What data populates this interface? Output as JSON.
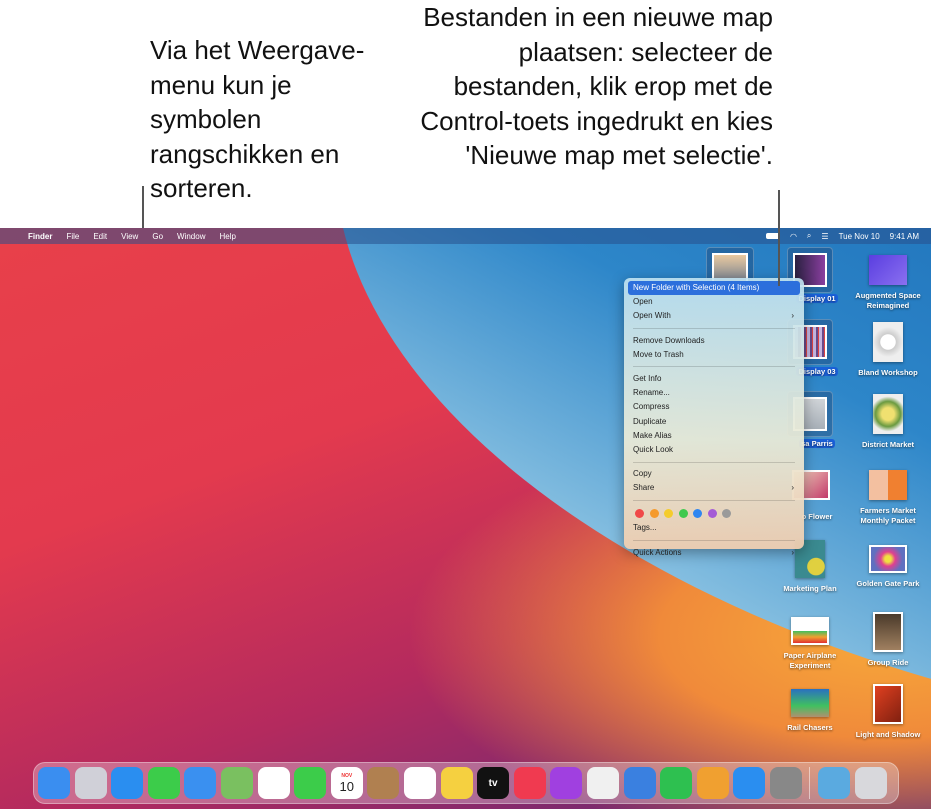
{
  "callouts": {
    "left": "Via het Weergave-menu kun je symbolen rangschikken en sorteren.",
    "right": "Bestanden in een nieuwe map plaatsen: selecteer de bestanden, klik erop met de Control-toets ingedrukt en kies 'Nieuwe map met selectie'."
  },
  "menubar": {
    "apple": "",
    "items": [
      "Finder",
      "File",
      "Edit",
      "View",
      "Go",
      "Window",
      "Help"
    ],
    "date": "Tue Nov 10",
    "time": "9:41 AM"
  },
  "context_menu": {
    "items": [
      "New Folder with Selection (4 Items)",
      "Open",
      "Open With",
      "Remove Downloads",
      "Move to Trash",
      "Get Info",
      "Rename...",
      "Compress",
      "Duplicate",
      "Make Alias",
      "Quick Look",
      "Copy",
      "Share",
      "Tags...",
      "Quick Actions"
    ],
    "tag_colors": [
      "#f04848",
      "#f59a2c",
      "#f5cc2c",
      "#3fc94e",
      "#2f86f0",
      "#a45bd6",
      "#9a9a9a"
    ]
  },
  "desktop": {
    "selected": [
      "Display 01",
      "Display 03",
      "sa Parris"
    ],
    "other_partial": [
      "o Flower"
    ],
    "icons": [
      "Augmented Space Reimagined",
      "Bland Workshop",
      "District Market",
      "Farmers Market Monthly Packet",
      "Golden Gate Park",
      "Group Ride",
      "Light and Shadow",
      "Marketing Plan",
      "Paper Airplane Experiment",
      "Rail Chasers"
    ]
  },
  "dock": {
    "apps": [
      "Finder",
      "Launchpad",
      "Safari",
      "Messages",
      "Mail",
      "Maps",
      "Photos",
      "FaceTime",
      "Calendar",
      "Contacts",
      "Reminders",
      "Notes",
      "TV",
      "Music",
      "Podcasts",
      "News",
      "Keynote",
      "Numbers",
      "Pages",
      "App Store",
      "System Preferences",
      "Downloads",
      "Trash"
    ],
    "calendar_month": "NOV",
    "calendar_day": "10",
    "tv_label": "tv"
  }
}
